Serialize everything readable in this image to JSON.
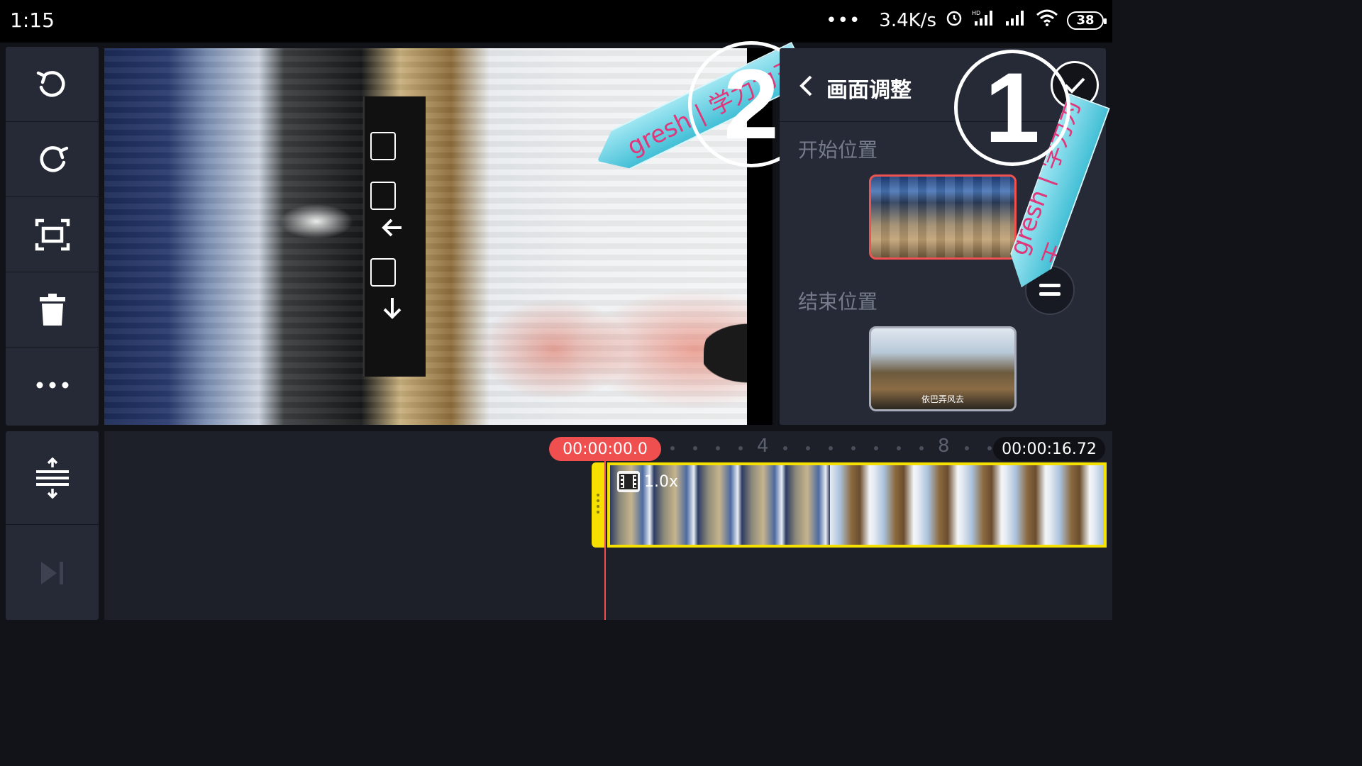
{
  "status_bar": {
    "time": "1:15",
    "more": "•••",
    "net_speed": "3.4K/s",
    "battery": "38"
  },
  "preview": {
    "left_annotation_number": "2",
    "left_annotation_tag": "gresh | 学力为王"
  },
  "panel": {
    "title": "画面调整",
    "start_label": "开始位置",
    "end_label": "结束位置",
    "end_thumb_caption": "依巴弄风去",
    "right_annotation_number": "1",
    "right_annotation_tag": "gresh | 学力为王"
  },
  "timeline": {
    "current_time": "00:00:00.0",
    "total_time": "00:00:16.72",
    "ruler_labels": [
      "4",
      "8"
    ],
    "clip_speed": "1.0x"
  },
  "toolbar": {
    "icons": [
      "undo-icon",
      "redo-icon",
      "crop-icon",
      "trash-icon",
      "more-icon"
    ],
    "lower_icons": [
      "split-icon",
      "skip-end-icon"
    ]
  },
  "colors": {
    "accent_red": "#f04f4f",
    "clip_yellow": "#f5e000",
    "panel_bg": "#262a36"
  }
}
